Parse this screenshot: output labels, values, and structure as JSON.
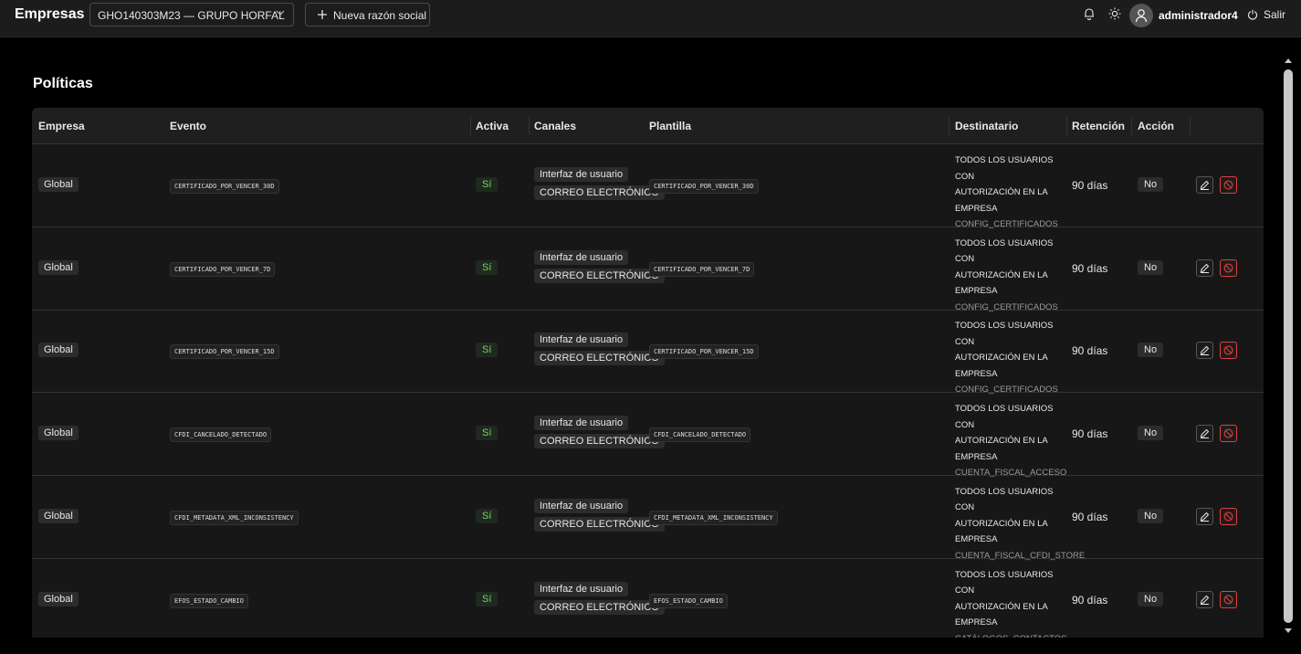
{
  "header": {
    "brand": "Empresas",
    "company_select": "GHO140303M23 — GRUPO HORFAL",
    "new_company_label": "Nueva razón social",
    "username": "administrador4",
    "logout_label": "Salir"
  },
  "page": {
    "title": "Políticas"
  },
  "table": {
    "columns": [
      "Empresa",
      "Evento",
      "Activa",
      "Canales",
      "Plantilla",
      "Destinatario",
      "Retención",
      "Acción"
    ],
    "rows": [
      {
        "empresa": "Global",
        "evento": "CERTIFICADO_POR_VENCER_30D",
        "activa": "Sí",
        "canal1": "Interfaz de usuario",
        "canal2": "CORREO ELECTRÓNICO",
        "plantilla": "CERTIFICADO_POR_VENCER_30D",
        "dest1": "TODOS LOS USUARIOS CON",
        "dest2": "AUTORIZACIÓN EN LA",
        "dest3": "EMPRESA",
        "permiso": "CONFIG_CERTIFICADOS",
        "retencion": "90 días",
        "accion": "No"
      },
      {
        "empresa": "Global",
        "evento": "CERTIFICADO_POR_VENCER_7D",
        "activa": "Sí",
        "canal1": "Interfaz de usuario",
        "canal2": "CORREO ELECTRÓNICO",
        "plantilla": "CERTIFICADO_POR_VENCER_7D",
        "dest1": "TODOS LOS USUARIOS CON",
        "dest2": "AUTORIZACIÓN EN LA",
        "dest3": "EMPRESA",
        "permiso": "CONFIG_CERTIFICADOS",
        "retencion": "90 días",
        "accion": "No"
      },
      {
        "empresa": "Global",
        "evento": "CERTIFICADO_POR_VENCER_15D",
        "activa": "Sí",
        "canal1": "Interfaz de usuario",
        "canal2": "CORREO ELECTRÓNICO",
        "plantilla": "CERTIFICADO_POR_VENCER_15D",
        "dest1": "TODOS LOS USUARIOS CON",
        "dest2": "AUTORIZACIÓN EN LA",
        "dest3": "EMPRESA",
        "permiso": "CONFIG_CERTIFICADOS",
        "retencion": "90 días",
        "accion": "No"
      },
      {
        "empresa": "Global",
        "evento": "CFDI_CANCELADO_DETECTADO",
        "activa": "Sí",
        "canal1": "Interfaz de usuario",
        "canal2": "CORREO ELECTRÓNICO",
        "plantilla": "CFDI_CANCELADO_DETECTADO",
        "dest1": "TODOS LOS USUARIOS CON",
        "dest2": "AUTORIZACIÓN EN LA",
        "dest3": "EMPRESA",
        "permiso": "CUENTA_FISCAL_ACCESO",
        "retencion": "90 días",
        "accion": "No"
      },
      {
        "empresa": "Global",
        "evento": "CFDI_METADATA_XML_INCONSISTENCY",
        "activa": "Sí",
        "canal1": "Interfaz de usuario",
        "canal2": "CORREO ELECTRÓNICO",
        "plantilla": "CFDI_METADATA_XML_INCONSISTENCY",
        "dest1": "TODOS LOS USUARIOS CON",
        "dest2": "AUTORIZACIÓN EN LA",
        "dest3": "EMPRESA",
        "permiso": "CUENTA_FISCAL_CFDI_STORE",
        "retencion": "90 días",
        "accion": "No"
      },
      {
        "empresa": "Global",
        "evento": "EFOS_ESTADO_CAMBIO",
        "activa": "Sí",
        "canal1": "Interfaz de usuario",
        "canal2": "CORREO ELECTRÓNICO",
        "plantilla": "EFOS_ESTADO_CAMBIO",
        "dest1": "TODOS LOS USUARIOS CON",
        "dest2": "AUTORIZACIÓN EN LA",
        "dest3": "EMPRESA",
        "permiso": "CATÁLOGOS_CONTACTOS",
        "retencion": "90 días",
        "accion": "No"
      }
    ]
  },
  "icons": {
    "bell": "bell-icon",
    "theme": "sun-icon",
    "avatar": "user-icon",
    "logout": "power-icon",
    "edit": "pencil-icon",
    "disable": "ban-icon"
  },
  "colors": {
    "background": "#000000",
    "surface": "#171717",
    "header_bg": "#1c1c1c",
    "active_green": "#7ccf6a",
    "danger_red": "#e04040"
  }
}
